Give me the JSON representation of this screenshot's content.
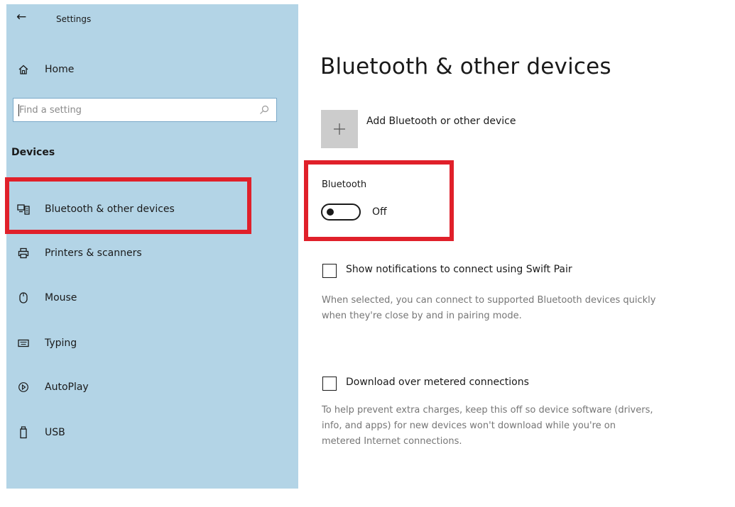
{
  "window": {
    "title": "Settings"
  },
  "sidebar": {
    "home_label": "Home",
    "search": {
      "placeholder": "Find a setting"
    },
    "section_heading": "Devices",
    "items": [
      {
        "label": "Bluetooth & other devices",
        "icon": "bluetooth-devices-icon",
        "selected": true
      },
      {
        "label": "Printers & scanners",
        "icon": "printer-icon",
        "selected": false
      },
      {
        "label": "Mouse",
        "icon": "mouse-icon",
        "selected": false
      },
      {
        "label": "Typing",
        "icon": "keyboard-icon",
        "selected": false
      },
      {
        "label": "AutoPlay",
        "icon": "autoplay-icon",
        "selected": false
      },
      {
        "label": "USB",
        "icon": "usb-icon",
        "selected": false
      }
    ]
  },
  "main": {
    "title": "Bluetooth & other devices",
    "add_device_label": "Add Bluetooth or other device",
    "bluetooth": {
      "label": "Bluetooth",
      "state": "Off",
      "enabled": false
    },
    "swift_pair": {
      "label": "Show notifications to connect using Swift Pair",
      "checked": false,
      "description_lines": [
        "When selected, you can connect to supported Bluetooth devices quickly",
        "when they're close by and in pairing mode."
      ]
    },
    "metered": {
      "label": "Download over metered connections",
      "checked": false,
      "description_lines": [
        "To help prevent extra charges, keep this off so device software (drivers,",
        "info, and apps) for new devices won't download while you're on",
        "metered Internet connections."
      ]
    }
  },
  "colors": {
    "sidebar_bg": "#b3d4e6",
    "highlight": "#e0202a",
    "tile_bg": "#cccccc",
    "description_text": "#767676"
  }
}
